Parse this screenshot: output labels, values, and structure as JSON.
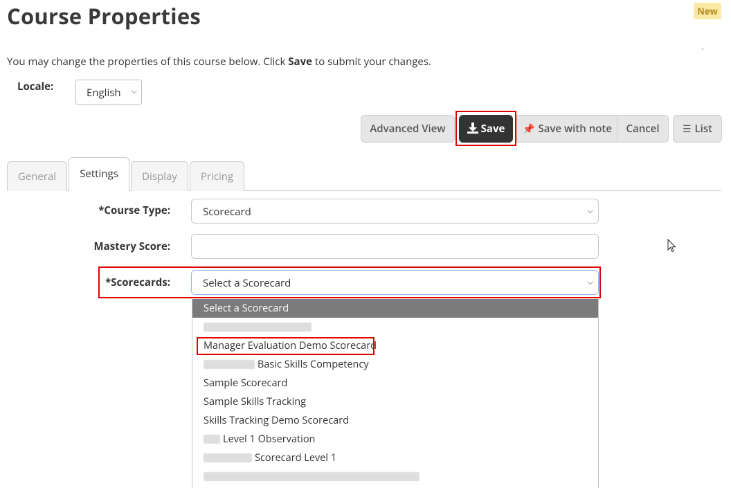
{
  "page": {
    "title": "Course Properties",
    "badge": "New",
    "intro_before": "You may change the properties of this course below. Click ",
    "intro_bold": "Save",
    "intro_after": " to submit your changes."
  },
  "locale": {
    "label": "Locale:",
    "value": "English"
  },
  "toolbar": {
    "advanced_view": "Advanced View",
    "save": "Save",
    "save_with_note": "Save with note",
    "cancel": "Cancel",
    "list": "List"
  },
  "tabs": [
    {
      "label": "General"
    },
    {
      "label": "Settings"
    },
    {
      "label": "Display"
    },
    {
      "label": "Pricing"
    }
  ],
  "form": {
    "course_type": {
      "label": "*Course Type:",
      "value": "Scorecard"
    },
    "mastery_score": {
      "label": "Mastery Score:",
      "value": ""
    },
    "scorecards": {
      "label": "*Scorecards:",
      "value": "Select a Scorecard"
    }
  },
  "dropdown_options": [
    {
      "label": "Select a Scorecard"
    },
    {
      "label": ""
    },
    {
      "label": "Manager Evaluation Demo Scorecard"
    },
    {
      "label": "Basic Skills Competency"
    },
    {
      "label": "Sample Scorecard"
    },
    {
      "label": "Sample Skills Tracking"
    },
    {
      "label": "Skills Tracking Demo Scorecard"
    },
    {
      "label": "Level 1 Observation"
    },
    {
      "label": "Scorecard Level 1"
    },
    {
      "label": ""
    }
  ],
  "colors": {
    "highlight": "#e00000",
    "save_button": "#333333",
    "selected_option": "#7b7b7b"
  }
}
